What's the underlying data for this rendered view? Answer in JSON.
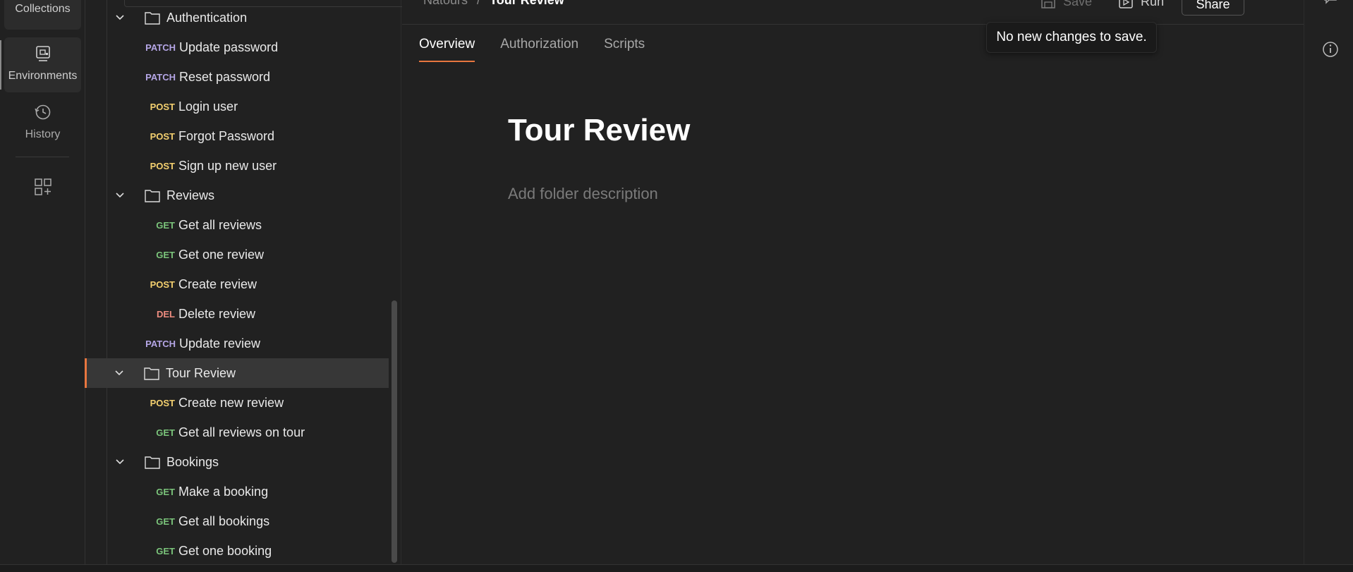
{
  "rail": {
    "collections_label": "Collections",
    "environments_label": "Environments",
    "history_label": "History"
  },
  "tree": {
    "folder_auth": "Authentication",
    "auth_items": [
      {
        "method": "PATCH",
        "name": "Update password"
      },
      {
        "method": "PATCH",
        "name": "Reset password"
      },
      {
        "method": "POST",
        "name": "Login user"
      },
      {
        "method": "POST",
        "name": "Forgot Password"
      },
      {
        "method": "POST",
        "name": "Sign up new user"
      }
    ],
    "folder_reviews": "Reviews",
    "reviews_items": [
      {
        "method": "GET",
        "name": "Get all reviews"
      },
      {
        "method": "GET",
        "name": "Get one review"
      },
      {
        "method": "POST",
        "name": "Create review"
      },
      {
        "method": "DEL",
        "name": "Delete review"
      },
      {
        "method": "PATCH",
        "name": "Update review"
      }
    ],
    "folder_tour_review": "Tour Review",
    "tour_review_items": [
      {
        "method": "POST",
        "name": "Create new review"
      },
      {
        "method": "GET",
        "name": "Get all reviews on tour"
      }
    ],
    "folder_bookings": "Bookings",
    "bookings_items": [
      {
        "method": "GET",
        "name": "Make a booking"
      },
      {
        "method": "GET",
        "name": "Get all bookings"
      },
      {
        "method": "GET",
        "name": "Get one booking"
      }
    ]
  },
  "header": {
    "breadcrumb_parent": "Natours",
    "breadcrumb_sep": "/",
    "breadcrumb_current": "Tour Review",
    "save_label": "Save",
    "run_label": "Run",
    "share_label": "Share",
    "more_label": "•••"
  },
  "tabs": {
    "overview": "Overview",
    "authorization": "Authorization",
    "scripts": "Scripts"
  },
  "content": {
    "title": "Tour Review",
    "description_placeholder": "Add folder description"
  },
  "tooltip": {
    "text": "No new changes to save."
  },
  "colors": {
    "accent": "#e8763f",
    "get": "#7bc57b",
    "post": "#f4d06f",
    "patch": "#b5a6e6",
    "del": "#ef8d80"
  }
}
